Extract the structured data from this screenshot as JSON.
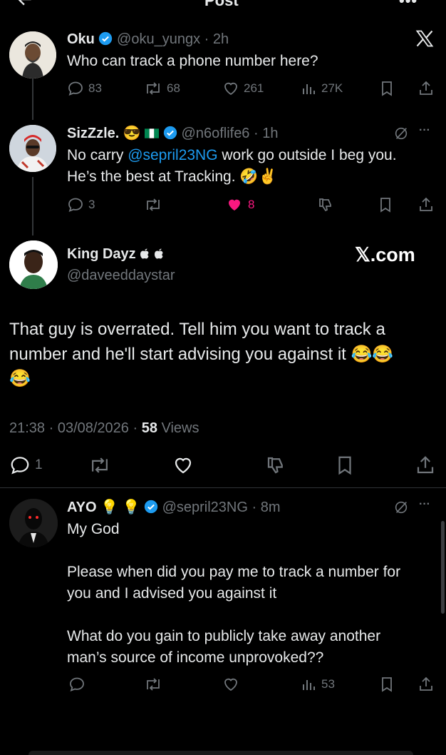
{
  "header": {
    "title": "Post"
  },
  "tweet1": {
    "name": "Oku",
    "handle": "@oku_yungx",
    "time": "2h",
    "text": "Who can track a phone number here?",
    "stats": {
      "replies": "83",
      "retweets": "68",
      "likes": "261",
      "views": "27K"
    }
  },
  "tweet2": {
    "name": "SizZzle.",
    "name_emoji": "😎",
    "handle": "@n6oflife6",
    "time": "1h",
    "text_pre": "No carry ",
    "mention": "@sepril23NG",
    "text_post": " work go outside I beg you.",
    "line2": "He’s the best at Tracking. 🤣✌️",
    "stats": {
      "replies": "3",
      "likes": "8"
    }
  },
  "tweet3": {
    "name": "King Dayz",
    "name_suffix": "",
    "handle": "@daveeddaystar",
    "watermark": "𝕏.com",
    "text_line1": "That guy is overrated. Tell him you want to track a",
    "text_line2": "number and he'll start advising you against it 😂😂",
    "text_line3": "😂",
    "timestamp": "21:38 · 03/08/2026 · ",
    "views_count": "58",
    "views_label": " Views",
    "stats": {
      "replies": "1"
    }
  },
  "tweet4": {
    "name": "AYO",
    "name_emoji": "💡 💡",
    "handle": "@sepril23NG",
    "time": "8m",
    "line1": "My God",
    "line2": "Please when did you pay me to track a number for",
    "line3": "you and I advised you against it",
    "line4": "What do you gain to publicly take away another",
    "line5": "man’s source of income unprovoked??",
    "stats": {
      "views": "53"
    }
  },
  "colors": {
    "accent": "#1d9bf0",
    "like": "#f91880",
    "muted": "#71767b",
    "text": "#e7e9ea"
  }
}
